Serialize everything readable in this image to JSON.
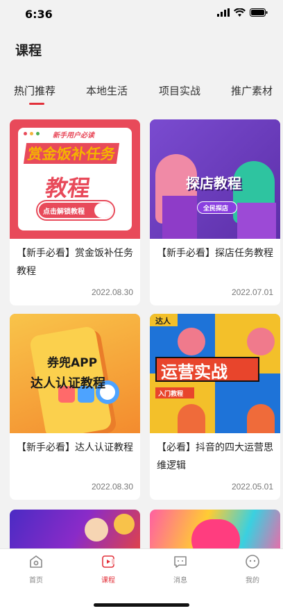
{
  "status": {
    "time": "6:36"
  },
  "header": {
    "title": "课程"
  },
  "tabs": [
    {
      "label": "热门推荐",
      "active": true
    },
    {
      "label": "本地生活",
      "active": false
    },
    {
      "label": "项目实战",
      "active": false
    },
    {
      "label": "推广素材",
      "active": false
    }
  ],
  "cards": [
    {
      "title": "【新手必看】赏金饭补任务教程",
      "date": "2022.08.30",
      "cover": {
        "small": "新手用户必读",
        "main1": "赏金饭补任务",
        "main2": "教程",
        "button": "点击解锁教程"
      }
    },
    {
      "title": "【新手必看】探店任务教程",
      "date": "2022.07.01",
      "cover": {
        "main": "探店教程",
        "badge": "全民探店"
      }
    },
    {
      "title": "【新手必看】达人认证教程",
      "date": "2022.08.30",
      "cover": {
        "main1": "券兜APP",
        "main2": "达人认证教程"
      }
    },
    {
      "title": "【必看】抖音的四大运营思维逻辑",
      "date": "2022.05.01",
      "cover": {
        "tag": "达人",
        "main": "运营实战",
        "badge": "入门教程"
      }
    }
  ],
  "tabbar": [
    {
      "label": "首页",
      "icon": "home-icon",
      "active": false
    },
    {
      "label": "课程",
      "icon": "course-icon",
      "active": true
    },
    {
      "label": "消息",
      "icon": "message-icon",
      "active": false
    },
    {
      "label": "我的",
      "icon": "profile-icon",
      "active": false
    }
  ],
  "colors": {
    "accent": "#e2303a",
    "background": "#f2f2f2"
  }
}
